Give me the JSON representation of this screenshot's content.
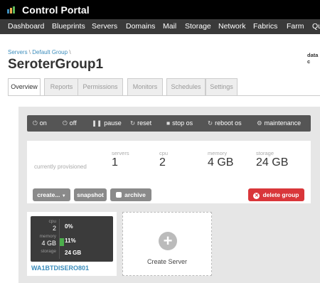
{
  "header": {
    "brand": "Control Portal",
    "logo_colors": [
      "#3c8dbc",
      "#f0ad4e",
      "#5cb85c"
    ]
  },
  "nav": {
    "items": [
      "Dashboard",
      "Blueprints",
      "Servers",
      "Domains",
      "Mail",
      "Storage",
      "Network",
      "Fabrics",
      "Farm",
      "Qu"
    ]
  },
  "breadcrumb": {
    "link1": "Servers",
    "sep1": "\\",
    "link2": "Default Group",
    "sep2": "\\"
  },
  "right_cut_text": "data c",
  "page_title": "SeroterGroup1",
  "tabs": [
    "Overview",
    "Reports",
    "Permissions",
    "Monitors",
    "Schedules",
    "Settings"
  ],
  "active_tab": "Overview",
  "actions": {
    "on": "on",
    "off": "off",
    "pause": "pause",
    "reset": "reset",
    "stop_os": "stop os",
    "reboot_os": "reboot os",
    "maintenance": "maintenance"
  },
  "stats": {
    "caption": "currently provisioned",
    "servers_label": "servers",
    "servers_value": "1",
    "cpu_label": "cpu",
    "cpu_value": "2",
    "memory_label": "memory",
    "memory_value": "4 GB",
    "storage_label": "storage",
    "storage_value": "24 GB"
  },
  "buttons": {
    "create": "create...",
    "snapshot": "snapshot",
    "archive": "archive",
    "delete_group": "delete group"
  },
  "server_card": {
    "cpu_label": "cpu",
    "cpu_value": "2",
    "cpu_pct": "0%",
    "cpu_usage": 0,
    "memory_label": "memory",
    "memory_value": "4 GB",
    "memory_pct": "11%",
    "memory_usage": 0.11,
    "storage_label": "storage",
    "storage_value": "24 GB",
    "name": "WA1BTDISERO801"
  },
  "create_server": {
    "label": "Create Server"
  },
  "colors": {
    "accent_blue": "#3c8dbc",
    "danger_red": "#d9363a",
    "usage_green": "#4cae4c"
  }
}
